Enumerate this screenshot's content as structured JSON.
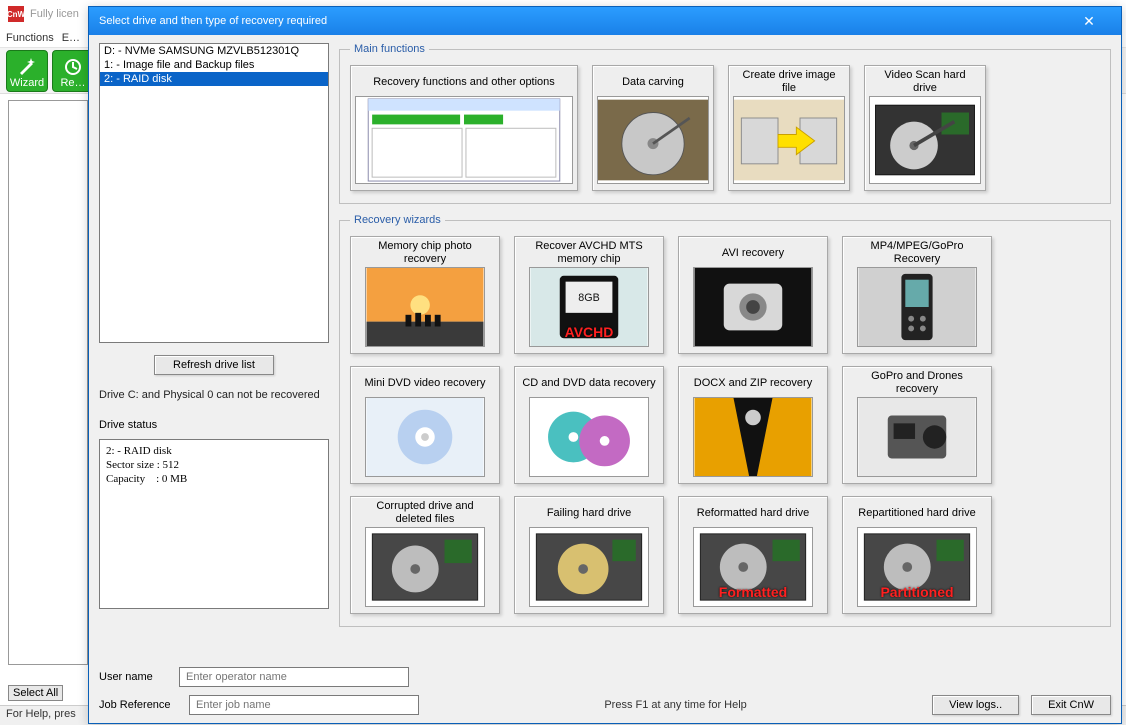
{
  "bg": {
    "title": "Fully licen",
    "menu": {
      "functions": "Functions",
      "edit": "E…"
    },
    "toolbar": {
      "wizard": "Wizard",
      "recover": "Re…"
    },
    "selectAll": "Select All",
    "status": "For Help, pres"
  },
  "dialog": {
    "title": "Select drive and then type of recovery required",
    "drives": [
      "D: - NVMe     SAMSUNG MZVLB512301Q",
      "1: - Image file and Backup files",
      "2: - RAID disk"
    ],
    "selectedDriveIndex": 2,
    "refresh": "Refresh drive list",
    "note": "Drive C: and Physical 0 can not be recovered",
    "driveStatusLabel": "Drive status",
    "driveStatusText": "2: - RAID disk\nSector size : 512\nCapacity    : 0 MB",
    "groups": {
      "main": "Main functions",
      "wizards": "Recovery wizards"
    },
    "mainCards": [
      {
        "label": "Recovery functions and other options"
      },
      {
        "label": "Data carving"
      },
      {
        "label": "Create drive image file"
      },
      {
        "label": "Video Scan hard drive"
      }
    ],
    "wizardCards": [
      {
        "label": "Memory chip photo recovery"
      },
      {
        "label": "Recover AVCHD MTS memory chip",
        "overlay": "AVCHD"
      },
      {
        "label": "AVI recovery"
      },
      {
        "label": "MP4/MPEG/GoPro Recovery"
      },
      {
        "label": "Mini DVD video recovery"
      },
      {
        "label": "CD and DVD data recovery"
      },
      {
        "label": "DOCX and ZIP recovery"
      },
      {
        "label": "GoPro and Drones recovery"
      },
      {
        "label": "Corrupted drive and deleted files"
      },
      {
        "label": "Failing hard drive"
      },
      {
        "label": "Reformatted hard drive",
        "overlay": "Formatted"
      },
      {
        "label": "Repartitioned hard drive",
        "overlay": "Partitioned"
      }
    ],
    "userNameLabel": "User name",
    "userNamePlaceholder": "Enter operator name",
    "jobRefLabel": "Job Reference",
    "jobRefPlaceholder": "Enter job name",
    "hint": "Press F1 at any time for Help",
    "viewLogs": "View logs..",
    "exit": "Exit CnW"
  }
}
